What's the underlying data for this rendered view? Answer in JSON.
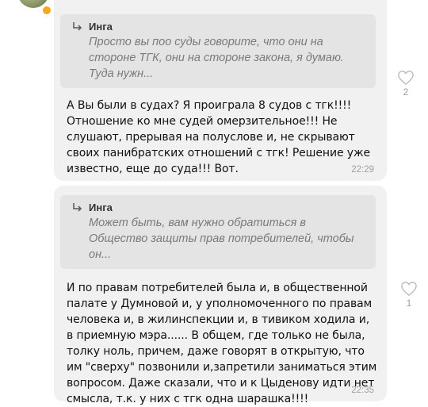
{
  "messages": [
    {
      "quote": {
        "author": "Инга",
        "text": "Просто вы поо суды говорите, что они на стороне ТГК, они на стороне закона, я думаю. Туда нужн..."
      },
      "text": "А Вы были в судах? Я проиграла 8 судов с тгк!!!! Отношение ко мне судей омерзительное!!! Не слушают, прерывая на полуслове и, не скрывают своих панибратских отношений с тгк! Решение уже известно, еще до суда!!! Вот.",
      "time": "22:29",
      "likes": "2"
    },
    {
      "quote": {
        "author": "Инга",
        "text": "Может быть, вам нужно обратиться в Общество защиты прав потребителей, чтобы он..."
      },
      "text": "И по правам потребителей была и, в общественной палате у Думновой и, у уполномоченного по правам человека и, в жилинспекции и, в тивиком ходила и, в приемную мэра...... В общем, где только не была, толку ноль, причем, даже говорят в открытую, что им \"сверху\" позвонили и,запретили заниматься этим вопросом. Даже сказали, что и к Цыденову идти нет смысла, т.к. у них с тгк одна шарашка!!!!",
      "time": "22:35",
      "likes": "1"
    }
  ],
  "colors": {
    "bubble_bg": "#f1f1f1",
    "quote_bg": "#e4e4e4",
    "online": "#f5a623"
  },
  "icons": [
    "reply-arrow-icon",
    "heart-icon"
  ]
}
